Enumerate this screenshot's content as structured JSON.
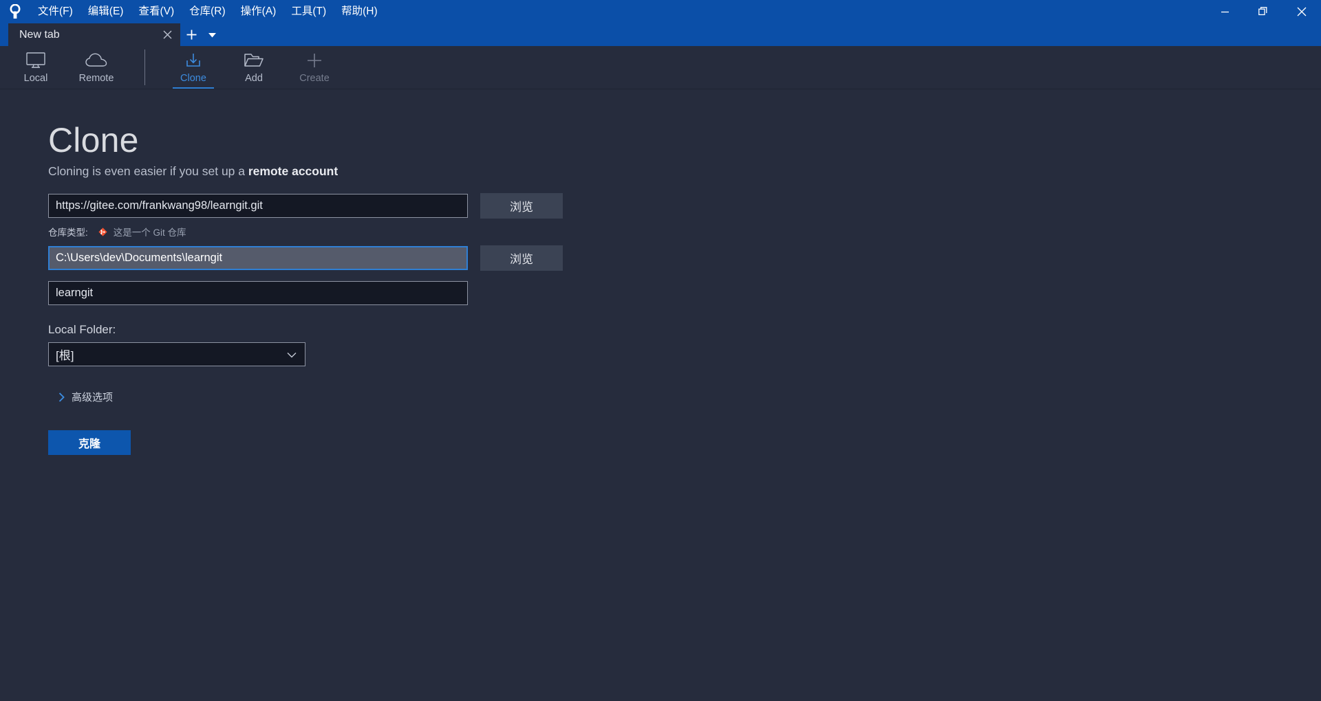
{
  "window": {
    "logo_icon": "sourcetree-logo-icon",
    "controls": [
      {
        "name": "minimize",
        "icon": "minimize-icon"
      },
      {
        "name": "restore",
        "icon": "restore-icon"
      },
      {
        "name": "close",
        "icon": "close-icon"
      }
    ]
  },
  "menubar": {
    "items": [
      {
        "label": "文件(F)"
      },
      {
        "label": "编辑(E)"
      },
      {
        "label": "查看(V)"
      },
      {
        "label": "仓库(R)"
      },
      {
        "label": "操作(A)"
      },
      {
        "label": "工具(T)"
      },
      {
        "label": "帮助(H)"
      }
    ]
  },
  "tabs": {
    "items": [
      {
        "label": "New tab",
        "active": true,
        "close_icon": "close-icon"
      }
    ],
    "new_tab_icon": "plus-icon",
    "tab_menu_icon": "chevron-down-icon"
  },
  "toolbar": {
    "groups": [
      {
        "items": [
          {
            "label": "Local",
            "icon": "monitor-icon",
            "active": false
          },
          {
            "label": "Remote",
            "icon": "cloud-icon",
            "active": false
          }
        ]
      },
      {
        "items": [
          {
            "label": "Clone",
            "icon": "clone-download-icon",
            "active": true
          },
          {
            "label": "Add",
            "icon": "folder-open-icon",
            "active": false
          },
          {
            "label": "Create",
            "icon": "plus-icon",
            "active": false
          }
        ]
      }
    ]
  },
  "main": {
    "title": "Clone",
    "subtitle_prefix": "Cloning is even easier if you set up a ",
    "subtitle_strong": "remote account",
    "source_url": {
      "value": "https://gitee.com/frankwang98/learngit.git",
      "placeholder": "",
      "browse_label": "浏览"
    },
    "repo_type": {
      "label": "仓库类型:",
      "icon": "git-diamond-icon",
      "icon_color": "#f1502f",
      "value": "这是一个 Git 仓库"
    },
    "destination_path": {
      "value": "C:\\Users\\dev\\Documents\\learngit",
      "placeholder": "",
      "browse_label": "浏览",
      "focused": true
    },
    "name": {
      "value": "learngit",
      "placeholder": ""
    },
    "local_folder": {
      "label": "Local Folder:",
      "selected": "[根]",
      "options": [
        "[根]"
      ],
      "chevron_icon": "chevron-down-icon"
    },
    "advanced": {
      "label": "高级选项",
      "chevron_icon": "chevron-right-icon",
      "expanded": false
    },
    "clone_button": {
      "label": "克隆"
    }
  },
  "colors": {
    "title_bar": "#0b4fa8",
    "app_bg": "#262c3d",
    "accent_blue": "#2f7fd4",
    "primary_button": "#0d56ad",
    "input_bg": "#141824",
    "git_orange": "#f1502f"
  }
}
